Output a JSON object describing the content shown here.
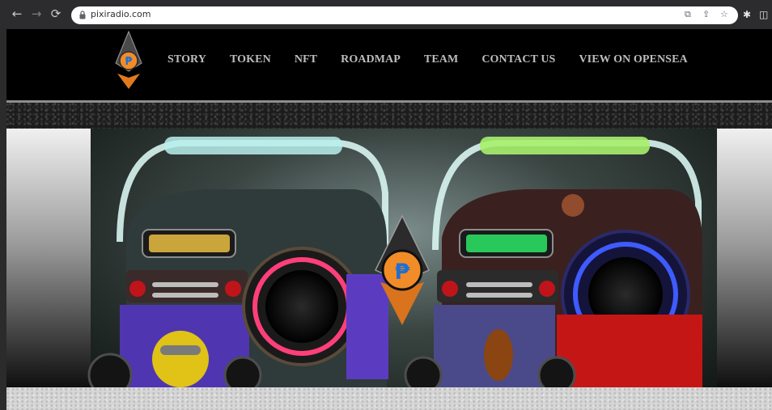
{
  "browser": {
    "url": "pixiradio.com",
    "back_icon": "arrow-left-icon",
    "forward_icon": "arrow-right-icon",
    "reload_icon": "reload-icon"
  },
  "site": {
    "nav": [
      {
        "label": "STORY"
      },
      {
        "label": "TOKEN"
      },
      {
        "label": "NFT"
      },
      {
        "label": "ROADMAP"
      },
      {
        "label": "TEAM"
      },
      {
        "label": "CONTACT US"
      },
      {
        "label": "VIEW ON OPENSEA"
      }
    ],
    "logo_glyph": "₱",
    "colors": {
      "accent_orange": "#f28c28",
      "logo_blue": "#1f6fd1",
      "neon_pink": "#ff3f7a",
      "neon_blue": "#3f5bff",
      "neon_green": "#29ff6a",
      "neon_yellow": "#f1c84a"
    }
  }
}
